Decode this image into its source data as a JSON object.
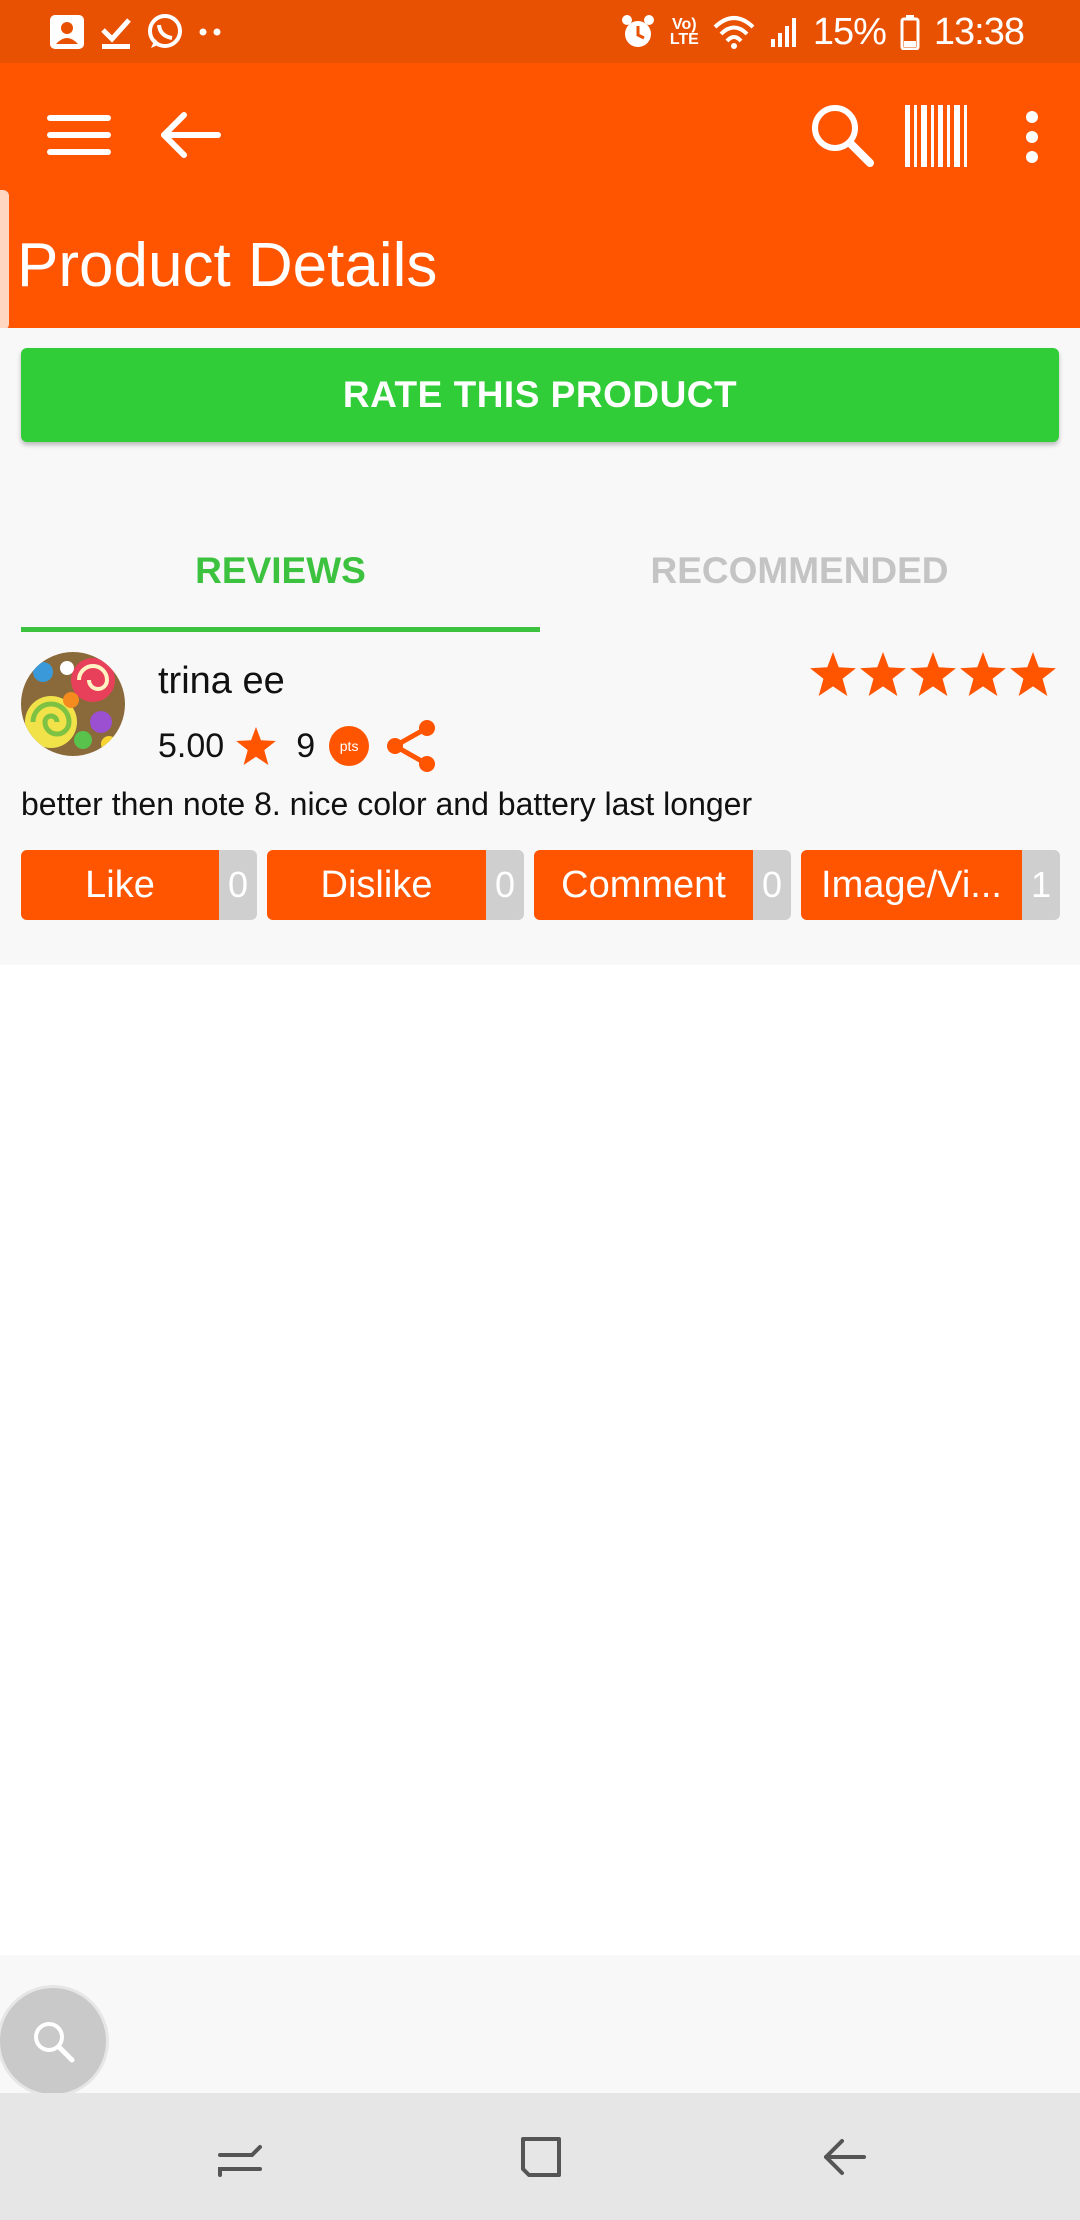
{
  "status_bar": {
    "battery_percent": "15%",
    "time": "13:38",
    "volte_top": "Vo)",
    "volte_bottom": "LTE",
    "left_icons": [
      "contact-icon",
      "checkmark-icon",
      "whatsapp-icon",
      "more-dots-icon"
    ],
    "right_icons": [
      "alarm-icon",
      "wifi-icon",
      "signal-icon",
      "battery-icon"
    ]
  },
  "toolbar": {
    "title": "Product Details",
    "icons": [
      "menu-icon",
      "back-arrow-icon",
      "search-icon",
      "barcode-icon",
      "overflow-menu-icon"
    ]
  },
  "rate_button": {
    "label": "RATE THIS PRODUCT",
    "color": "#31cd39"
  },
  "tabs": [
    {
      "label": "REVIEWS",
      "active": true
    },
    {
      "label": "RECOMMENDED",
      "active": false
    }
  ],
  "review": {
    "user": "trina ee",
    "user_rating": "5.00",
    "points": "9",
    "points_badge": "pts",
    "stars": 5,
    "text": "better then note 8. nice color and battery last longer",
    "actions": [
      {
        "label": "Like",
        "count": "0"
      },
      {
        "label": "Dislike",
        "count": "0"
      },
      {
        "label": "Comment",
        "count": "0"
      },
      {
        "label": "Image/Vi...",
        "count": "1"
      }
    ]
  },
  "colors": {
    "accent": "#ff5400",
    "status_bar": "#e85002",
    "active_tab": "#3cc23f",
    "inactive_tab": "#c4c4c4"
  }
}
